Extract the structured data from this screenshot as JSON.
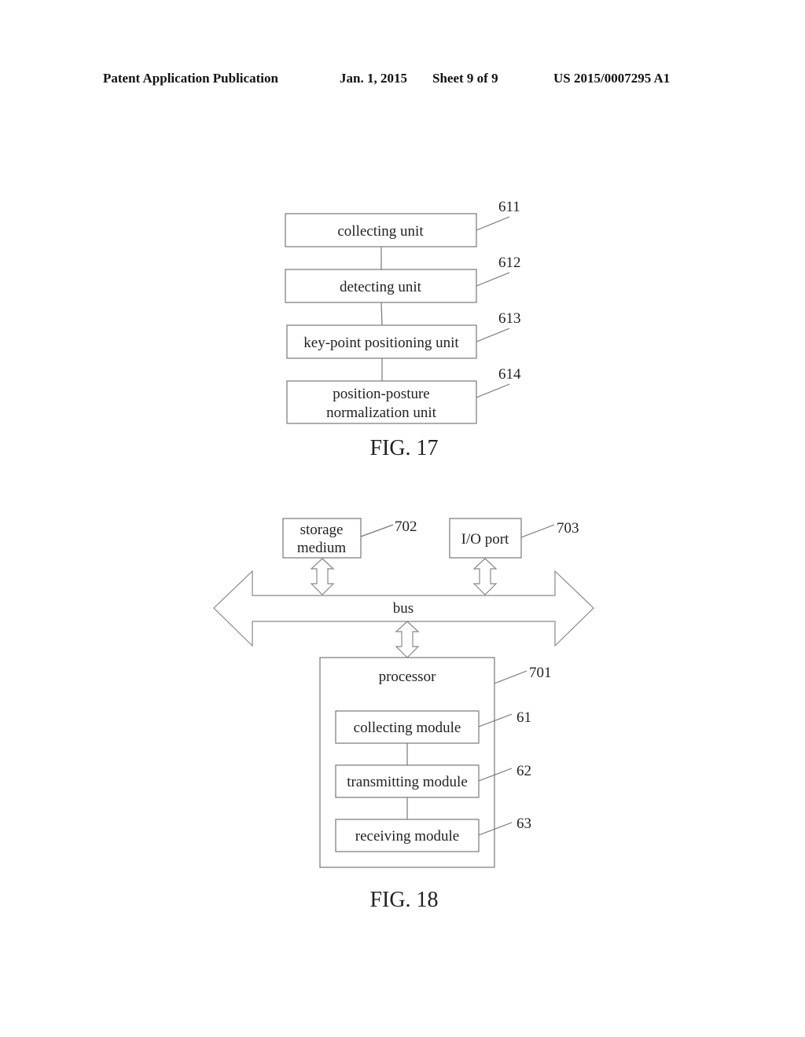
{
  "header": {
    "publication": "Patent Application Publication",
    "date": "Jan. 1, 2015",
    "sheet": "Sheet 9 of 9",
    "number": "US 2015/0007295 A1"
  },
  "fig17": {
    "caption": "FIG. 17",
    "units": [
      {
        "lines": [
          "collecting unit"
        ],
        "ref": "611"
      },
      {
        "lines": [
          "detecting unit"
        ],
        "ref": "612"
      },
      {
        "lines": [
          "key-point positioning unit"
        ],
        "ref": "613"
      },
      {
        "lines": [
          "position-posture",
          "normalization unit"
        ],
        "ref": "614"
      }
    ]
  },
  "fig18": {
    "caption": "FIG. 18",
    "storage": {
      "lines": [
        "storage",
        "medium"
      ],
      "ref": "702"
    },
    "io": {
      "label": "I/O port",
      "ref": "703"
    },
    "bus": {
      "label": "bus"
    },
    "processor": {
      "label": "processor",
      "ref": "701"
    },
    "modules": [
      {
        "label": "collecting module",
        "ref": "61"
      },
      {
        "label": "transmitting module",
        "ref": "62"
      },
      {
        "label": "receiving module",
        "ref": "63"
      }
    ]
  }
}
